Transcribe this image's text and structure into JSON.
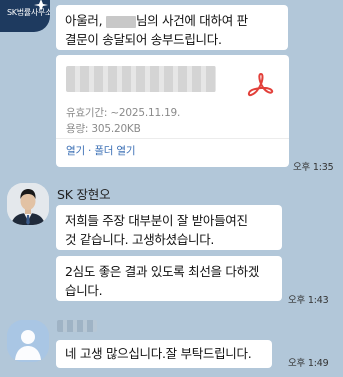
{
  "messages": {
    "m1": {
      "prefix": "아울러, ",
      "suffix": "님의 사건에 대하여 판",
      "line2": "결문이 송달되어 송부드립니다."
    },
    "file": {
      "expiry": "유효기간: ~2025.11.19.",
      "size": "용량: 305.20KB",
      "open": "열기",
      "sep": " · ",
      "folder": "폴더 열기",
      "time": "오후 1:35"
    },
    "lawyer": {
      "name": "SK 장현오",
      "msg1_line1": "저희들 주장 대부분이 잘 받아들여진",
      "msg1_line2": "것 같습니다. 고생하셨습니다.",
      "msg2_line1": "2심도 좋은 결과 있도록 최선을 다하겠",
      "msg2_line2": "습니다.",
      "time": "오후 1:43"
    },
    "client": {
      "msg": "네 고생 많으십니다.잘 부탁드립니다.",
      "time": "오후 1:49"
    }
  },
  "firm_logo_text": "SK법률사무소",
  "icons": {
    "firm_logo": "sk-logo-icon",
    "pdf": "pdf-file-icon",
    "default_avatar": "default-profile-icon"
  },
  "colors": {
    "chat_background": "#b2c7d9",
    "bubble": "#ffffff",
    "link": "#3b6fb5",
    "pdf_red": "#e2403a"
  }
}
